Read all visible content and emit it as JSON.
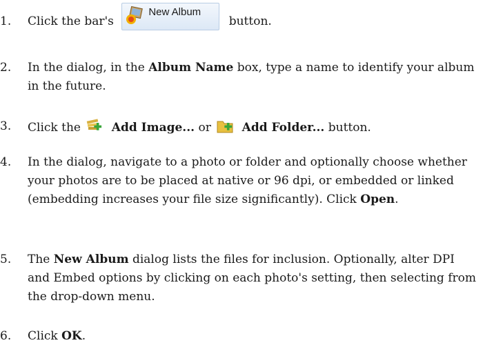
{
  "steps": [
    {
      "num": "1.",
      "before": "Click the bar's",
      "button_label": "New Album",
      "after": "button."
    },
    {
      "num": "2.",
      "before": "In the dialog, in the",
      "bold": "Album Name",
      "after": "box, type a name to identify your album in the future."
    },
    {
      "num": "3.",
      "before": "Click the",
      "bold1": "Add Image...",
      "mid": "or",
      "bold2": "Add Folder...",
      "after": "button."
    },
    {
      "num": "4.",
      "before": "In the dialog, navigate to a photo or folder and optionally choose whether your photos are to be placed at native or 96 dpi, or embedded or linked (embedding increases your file size significantly). Click",
      "bold": "Open",
      "after": "."
    },
    {
      "num": "5.",
      "before": "The",
      "bold": "New Album",
      "after": "dialog lists the files for inclusion. Optionally, alter DPI and Embed options by clicking on each photo's setting, then selecting from the drop-down menu."
    },
    {
      "num": "6.",
      "before": "Click",
      "bold": "OK",
      "after": "."
    }
  ],
  "icons": {
    "new_album": "new-album-icon",
    "add_image": "add-image-icon",
    "add_folder": "add-folder-icon"
  }
}
